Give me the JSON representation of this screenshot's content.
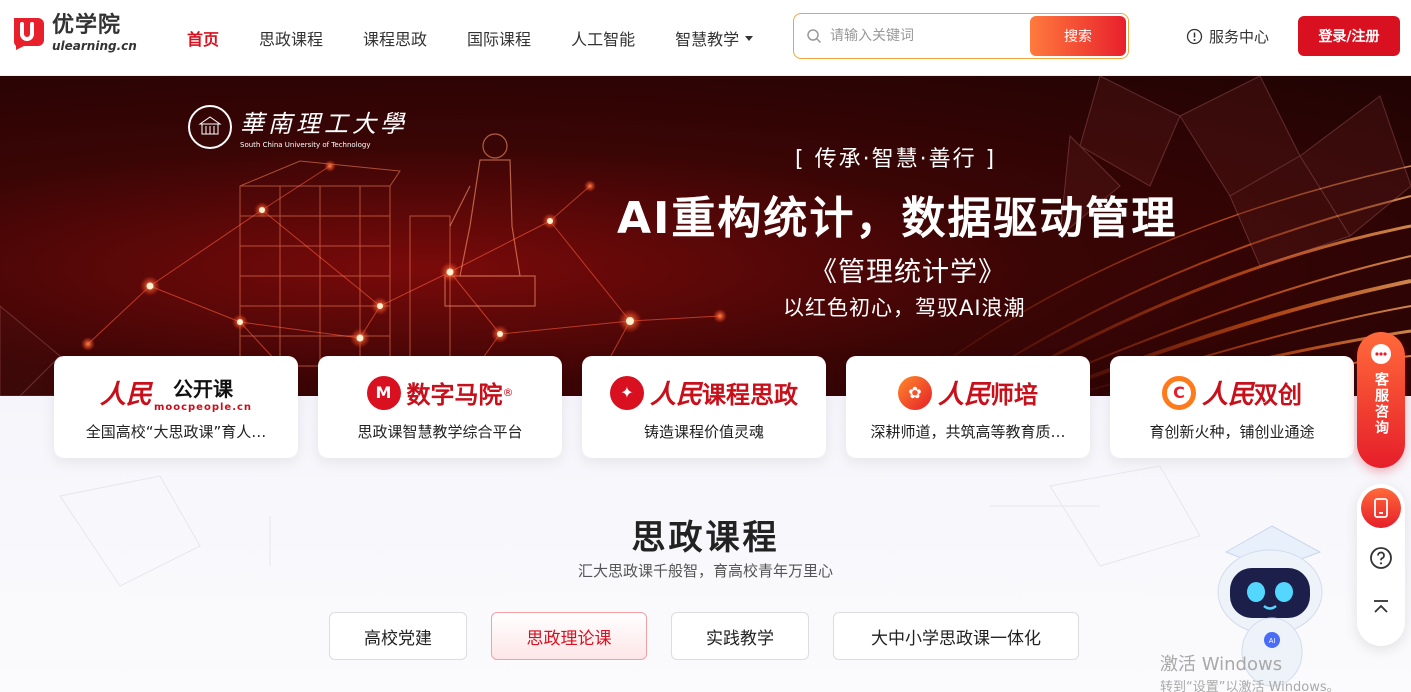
{
  "header": {
    "logo_cn": "优学院",
    "logo_en": "ulearning.cn",
    "nav": [
      "首页",
      "思政课程",
      "课程思政",
      "国际课程",
      "人工智能",
      "智慧教学"
    ],
    "search_placeholder": "请输入关键词",
    "search_button": "搜索",
    "service": "服务中心",
    "login": "登录/注册",
    "accent": "#d8101f"
  },
  "banner": {
    "university_cn": "華南理工大學",
    "university_en": "South China University of Technology",
    "slogan_small": "[ 传承·智慧·善行 ]",
    "slogan_big": "AI重构统计，数据驱动管理",
    "book": "《管理统计学》",
    "sub": "以红色初心，驾驭AI浪潮"
  },
  "cards": [
    {
      "brand_script": "人民",
      "brand": "公开课",
      "brand_en": "moocpeople.cn",
      "desc": "全国高校“大思政课”育人…"
    },
    {
      "brand_script": "",
      "brand": "数字马院",
      "reg": "®",
      "desc": "思政课智慧教学综合平台"
    },
    {
      "brand_script": "人民",
      "brand": "课程思政",
      "desc": "铸造课程价值灵魂"
    },
    {
      "brand_script": "人民",
      "brand": "师培",
      "desc": "深耕师道，共筑高等教育质…"
    },
    {
      "brand_script": "人民",
      "brand": "双创",
      "desc": "育创新火种，铺创业通途"
    }
  ],
  "section": {
    "title": "思政课程",
    "subtitle": "汇大思政课千般智，育高校青年万里心",
    "tabs": [
      "高校党建",
      "思政理论课",
      "实践教学",
      "大中小学思政课一体化"
    ],
    "active_tab": 1
  },
  "float": {
    "service": "客服咨询"
  },
  "watermark": {
    "line1": "激活 Windows",
    "line2": "转到“设置”以激活 Windows。"
  }
}
